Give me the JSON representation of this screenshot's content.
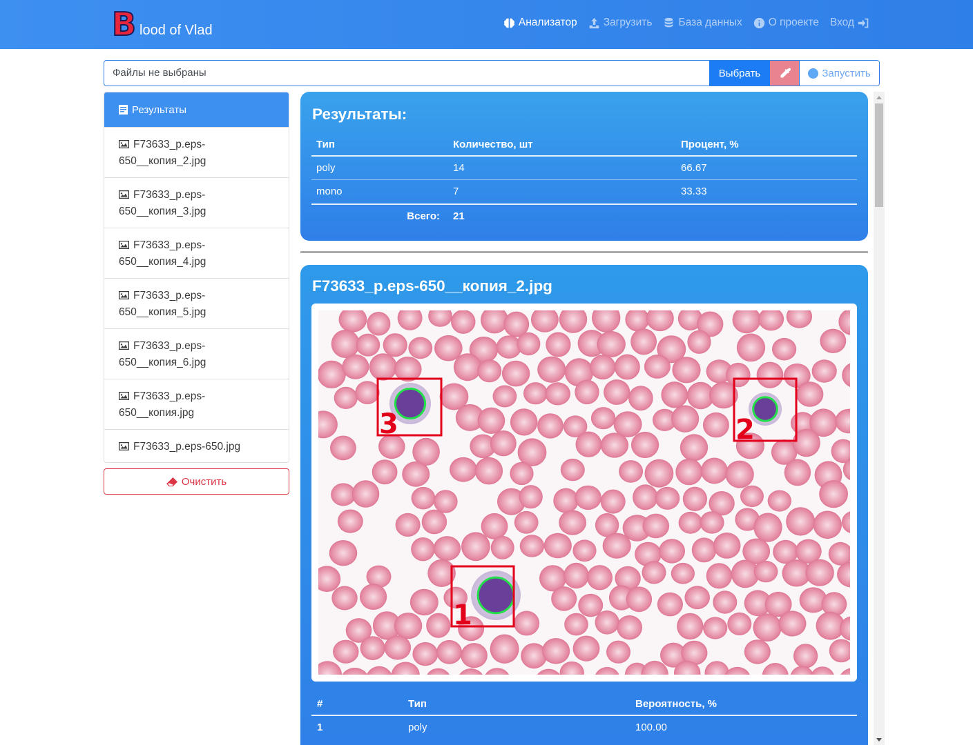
{
  "app": {
    "brand_letter": "B",
    "brand_text": "lood of Vlad",
    "brand_color": "#e8253a"
  },
  "nav": [
    {
      "label": "Анализатор",
      "icon": "brain-icon",
      "active": true
    },
    {
      "label": "Загрузить",
      "icon": "upload-icon",
      "active": false
    },
    {
      "label": "База данных",
      "icon": "database-icon",
      "active": false
    },
    {
      "label": "О проекте",
      "icon": "info-icon",
      "active": false
    },
    {
      "label": "Вход",
      "icon": "sign-in-icon",
      "active": false
    }
  ],
  "file_input": {
    "label": "Файлы не выбраны",
    "browse_label": "Выбрать",
    "run_label": "Запустить"
  },
  "sidebar": {
    "header": "Результаты",
    "files": [
      "F73633_p.eps-650__копия_2.jpg",
      "F73633_p.eps-650__копия_3.jpg",
      "F73633_p.eps-650__копия_4.jpg",
      "F73633_p.eps-650__копия_5.jpg",
      "F73633_p.eps-650__копия_6.jpg",
      "F73633_p.eps-650__копия.jpg",
      "F73633_p.eps-650.jpg"
    ],
    "clear_label": "Очистить"
  },
  "summary": {
    "title": "Результаты:",
    "columns": [
      "Тип",
      "Количество, шт",
      "Процент, %"
    ],
    "rows": [
      {
        "type": "poly",
        "count": "14",
        "percent": "66.67"
      },
      {
        "type": "mono",
        "count": "7",
        "percent": "33.33"
      }
    ],
    "total_label": "Всего:",
    "total_value": "21"
  },
  "image_card": {
    "title": "F73633_p.eps-650__копия_2.jpg",
    "detections": [
      {
        "label": "1"
      },
      {
        "label": "2"
      },
      {
        "label": "3"
      }
    ],
    "columns": [
      "#",
      "Тип",
      "Вероятность, %"
    ],
    "rows": [
      {
        "num": "1",
        "type": "poly",
        "prob": "100.00"
      }
    ]
  },
  "colors": {
    "primary": "#2f7fe8",
    "danger": "#dc3545",
    "detection_box": "#e3001b",
    "detection_outline": "#22e04a"
  }
}
